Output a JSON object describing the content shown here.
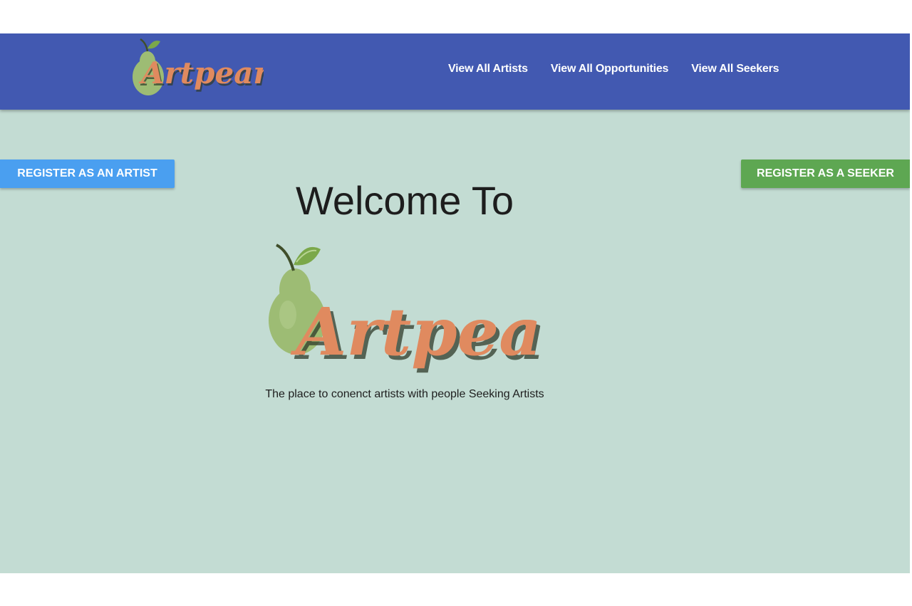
{
  "brand": {
    "name": "Artpear",
    "colors": {
      "navbar": "#4259b1",
      "background": "#c3dcd3",
      "logo_text": "#e08a5f",
      "pear_body": "#9dbc74",
      "leaf": "#7ba84a",
      "artist_button": "#4a9ff0",
      "seeker_button": "#5ea752"
    }
  },
  "nav": {
    "logo_icon": "pear-logo-icon",
    "links": [
      {
        "label": "View All Artists"
      },
      {
        "label": "View All Opportunities"
      },
      {
        "label": "View All Seekers"
      }
    ]
  },
  "actions": {
    "register_artist": "REGISTER AS AN ARTIST",
    "register_seeker": "REGISTER AS A SEEKER"
  },
  "hero": {
    "welcome": "Welcome To",
    "logo_text": "Artpear",
    "tagline": "The place to conenct artists with people Seeking Artists"
  }
}
